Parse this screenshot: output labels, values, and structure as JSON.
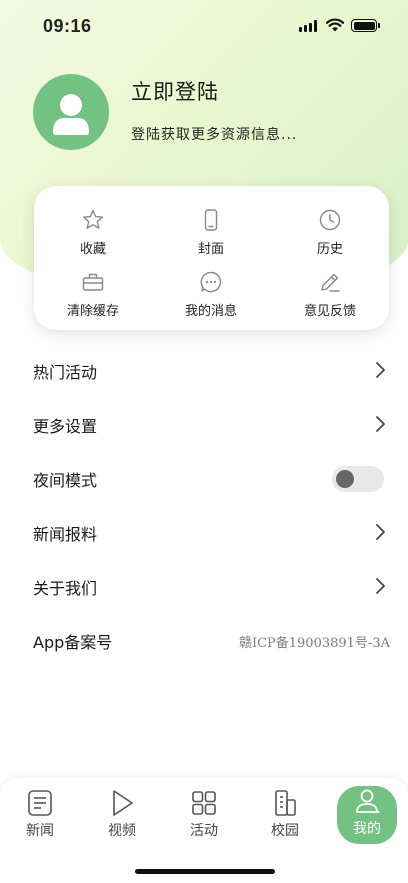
{
  "status_bar": {
    "time": "09:16"
  },
  "profile": {
    "title": "立即登陆",
    "subtitle": "登陆获取更多资源信息..."
  },
  "shortcuts": [
    {
      "label": "收藏",
      "icon": "star-icon"
    },
    {
      "label": "封面",
      "icon": "phone-icon"
    },
    {
      "label": "历史",
      "icon": "clock-icon"
    },
    {
      "label": "清除缓存",
      "icon": "toolbox-icon"
    },
    {
      "label": "我的消息",
      "icon": "message-icon"
    },
    {
      "label": "意见反馈",
      "icon": "pencil-icon"
    }
  ],
  "menu": {
    "hot_activities": "热门活动",
    "more_settings": "更多设置",
    "night_mode": "夜间模式",
    "news_report": "新闻报料",
    "about_us": "关于我们",
    "app_record_label": "App备案号",
    "app_record_value": "赣ICP备19003891号-3A"
  },
  "night_mode_on": false,
  "tabs": [
    {
      "label": "新闻",
      "icon": "news-icon"
    },
    {
      "label": "视频",
      "icon": "play-icon"
    },
    {
      "label": "活动",
      "icon": "grid-icon"
    },
    {
      "label": "校园",
      "icon": "building-icon"
    },
    {
      "label": "我的",
      "icon": "user-icon",
      "active": true
    }
  ],
  "colors": {
    "accent": "#74c283",
    "header_gradient_start": "#f4f9e3",
    "header_gradient_end": "#d7f0c9"
  }
}
